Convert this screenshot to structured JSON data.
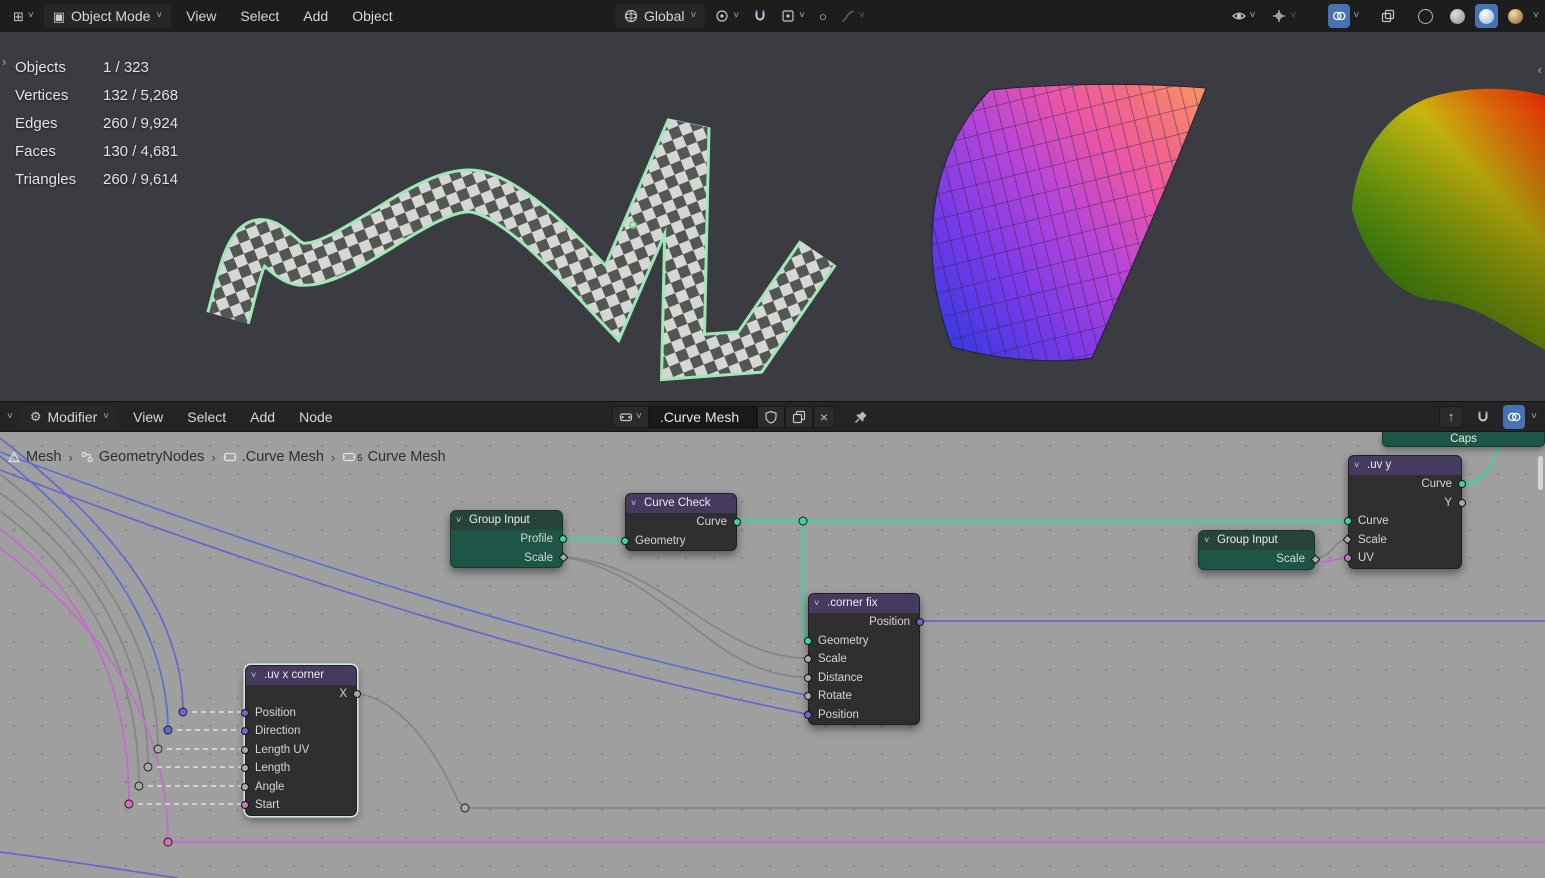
{
  "colors": {
    "accent_blue": "#4772b3",
    "wire_green": "#3fd39c",
    "wire_purple": "#6c63cc",
    "wire_blue": "#5a6fd0",
    "wire_pink": "#c668d2",
    "node_group_green": "#1d5646",
    "node_header_purple": "#463a60",
    "selection_outline": "#d4e6d8",
    "editor_background": "#9f9f9f",
    "viewport_background": "#3a3c42"
  },
  "icons": {
    "dropdown": "˅",
    "crumb_sep": "›",
    "close": "×",
    "mode_square": "▣",
    "editor_grid": "⊞",
    "gear": "⚙",
    "prop_circle": "○",
    "up_arrow": "↑",
    "chev_left": "‹",
    "chev_right": "›"
  },
  "viewport_header": {
    "mode": "Object Mode",
    "menus": [
      "View",
      "Select",
      "Add",
      "Object"
    ],
    "orientation": "Global"
  },
  "viewport": {
    "stats": [
      {
        "label": "Objects",
        "value": "1 / 323"
      },
      {
        "label": "Vertices",
        "value": "132 / 5,268"
      },
      {
        "label": "Edges",
        "value": "260 / 9,924"
      },
      {
        "label": "Faces",
        "value": "130 / 4,681"
      },
      {
        "label": "Triangles",
        "value": "260 / 9,614"
      }
    ]
  },
  "node_header": {
    "editor": "Modifier",
    "menus": [
      "View",
      "Select",
      "Add",
      "Node"
    ],
    "tree_name": ".Curve Mesh"
  },
  "breadcrumb": {
    "items": [
      "Mesh",
      "GeometryNodes",
      ".Curve Mesh",
      "Curve Mesh"
    ],
    "badge": "5"
  },
  "nodes": {
    "group_input_1": {
      "title": "Group Input",
      "rows": [
        {
          "label": "Profile"
        },
        {
          "label": "Scale"
        }
      ]
    },
    "curve_check": {
      "title": "Curve Check",
      "rows": [
        {
          "label": "Curve"
        },
        {
          "label": "Geometry"
        }
      ]
    },
    "corner_fix": {
      "title": ".corner fix",
      "rows": [
        {
          "label": "Position"
        },
        {
          "label": "Geometry"
        },
        {
          "label": "Scale"
        },
        {
          "label": "Distance"
        },
        {
          "label": "Rotate"
        },
        {
          "label": "Position"
        }
      ]
    },
    "uv_x_corner": {
      "title": ".uv x corner",
      "rows": [
        {
          "label": "X"
        },
        {
          "label": "Position"
        },
        {
          "label": "Direction"
        },
        {
          "label": "Length UV"
        },
        {
          "label": "Length"
        },
        {
          "label": "Angle"
        },
        {
          "label": "Start"
        }
      ]
    },
    "group_input_2": {
      "title": "Group Input",
      "rows": [
        {
          "label": "Scale"
        }
      ]
    },
    "uv_y": {
      "title": ".uv y",
      "rows": [
        {
          "label": "Curve"
        },
        {
          "label": "Y"
        },
        {
          "label": "Curve"
        },
        {
          "label": "Scale"
        },
        {
          "label": "UV"
        }
      ]
    },
    "caps": {
      "title": "Caps"
    }
  }
}
